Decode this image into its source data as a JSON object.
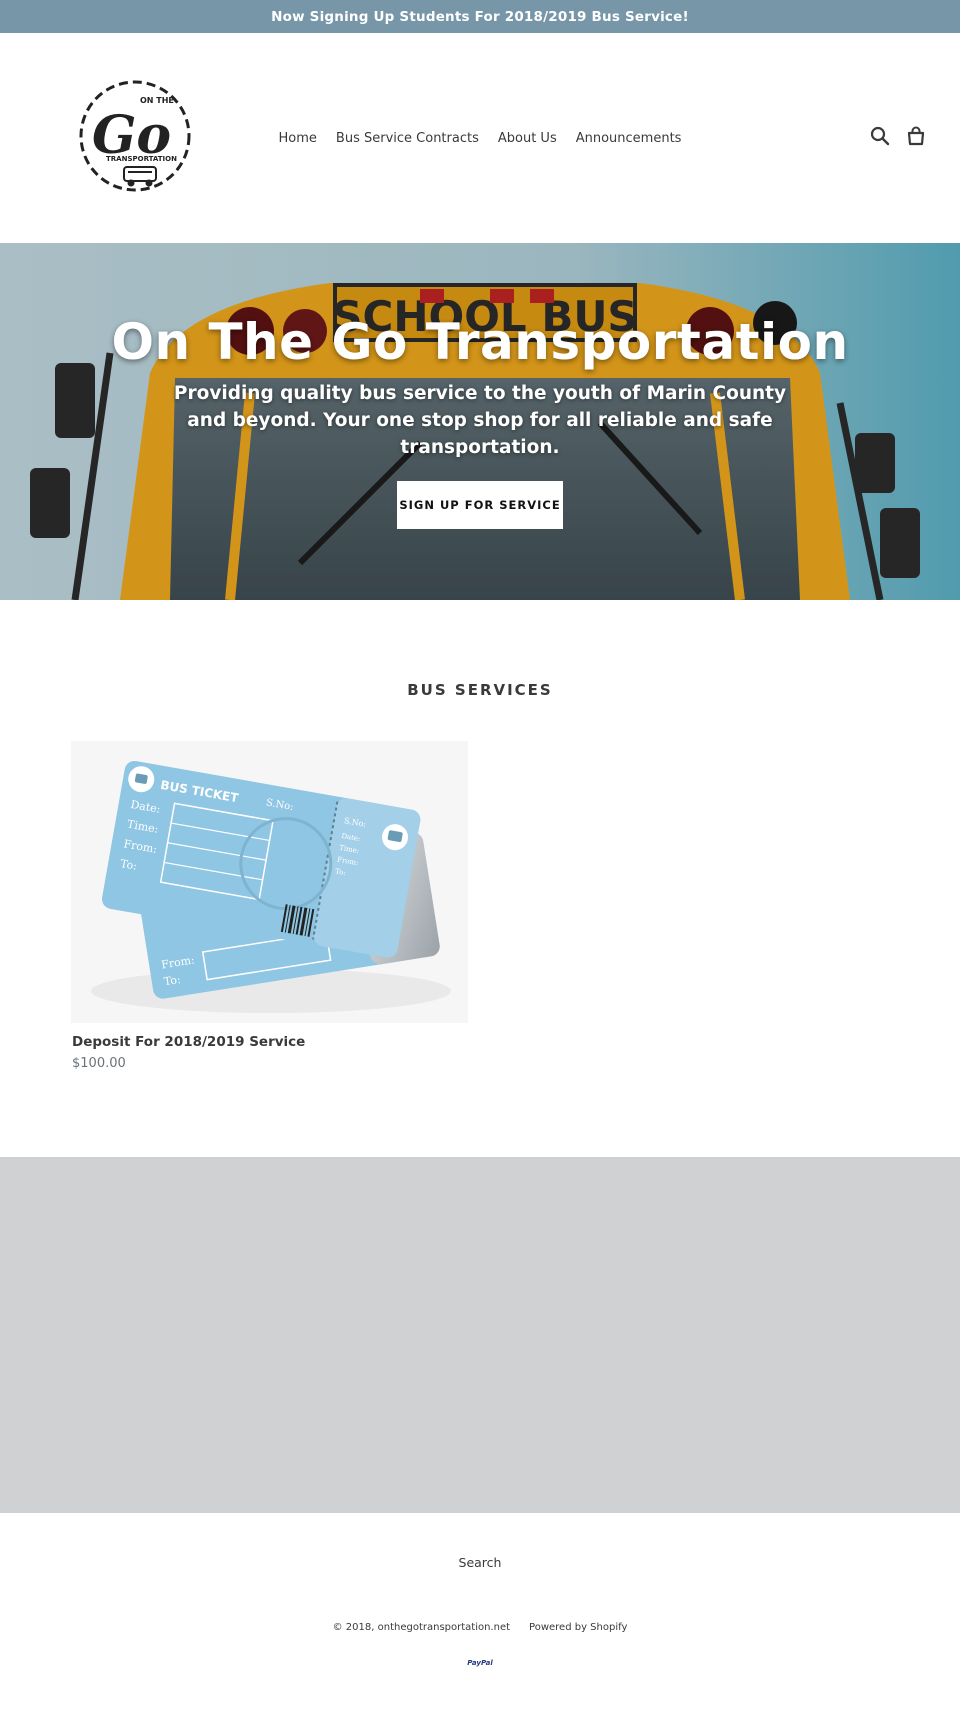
{
  "announcement": {
    "text": "Now Signing Up Students For 2018/2019 Bus Service!"
  },
  "header": {
    "logo": {
      "top_text": "ON THE",
      "main_text": "Go",
      "bottom_text": "TRANSPORTATION"
    },
    "nav": [
      {
        "label": "Home"
      },
      {
        "label": "Bus Service Contracts"
      },
      {
        "label": "About Us"
      },
      {
        "label": "Announcements"
      }
    ],
    "icons": {
      "search": "search-icon",
      "cart": "cart-icon"
    }
  },
  "hero": {
    "title": "On The Go Transportation",
    "subtitle": "Providing quality bus service to the youth of Marin County and beyond.  Your one stop shop for all reliable and safe transportation.",
    "button_label": "SIGN UP FOR SERVICE",
    "bus_sign": "SCHOOL BUS"
  },
  "bus_services": {
    "title": "BUS SERVICES",
    "products": [
      {
        "title": "Deposit For 2018/2019 Service",
        "price": "$100.00",
        "ticket": {
          "heading": "BUS TICKET",
          "sno": "S.No:",
          "date": "Date:",
          "time": "Time:",
          "from": "From:",
          "to": "To:"
        }
      }
    ]
  },
  "footer": {
    "search_link": "Search",
    "copyright": "© 2018, onthegotransportation.net",
    "powered_by": "Powered by Shopify",
    "payment": "PayPal"
  },
  "colors": {
    "announcement_bg": "#7796a8",
    "grey_band": "#cfd1d3",
    "text": "#3a3a3a",
    "price": "#69727b"
  }
}
